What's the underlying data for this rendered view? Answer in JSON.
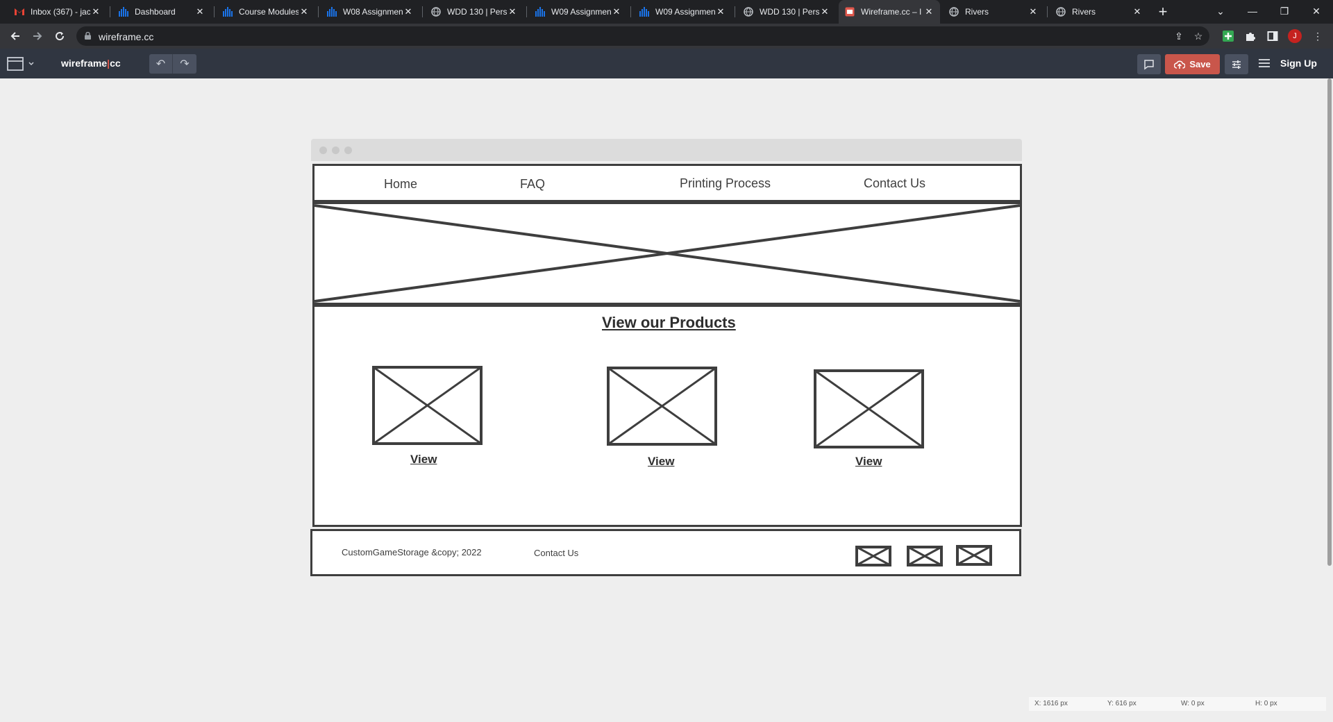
{
  "browser": {
    "tabs": [
      {
        "title": "Inbox (367) - jac",
        "icon": "gmail-icon",
        "active": false
      },
      {
        "title": "Dashboard",
        "icon": "canvas-icon",
        "active": false
      },
      {
        "title": "Course Modules",
        "icon": "canvas-icon",
        "active": false
      },
      {
        "title": "W08 Assignmen",
        "icon": "canvas-icon",
        "active": false
      },
      {
        "title": "WDD 130 | Pers",
        "icon": "globe-icon",
        "active": false
      },
      {
        "title": "W09 Assignmen",
        "icon": "canvas-icon",
        "active": false
      },
      {
        "title": "W09 Assignmen",
        "icon": "canvas-icon",
        "active": false
      },
      {
        "title": "WDD 130 | Pers",
        "icon": "globe-icon",
        "active": false
      },
      {
        "title": "Wireframe.cc – I",
        "icon": "wireframe-icon",
        "active": true
      },
      {
        "title": "Rivers",
        "icon": "globe-icon",
        "active": false
      },
      {
        "title": "Rivers",
        "icon": "globe-icon",
        "active": false
      }
    ],
    "url": "wireframe.cc",
    "profile_initial": "J",
    "accent_color": "#c9564b"
  },
  "app": {
    "logo_left": "wireframe",
    "logo_sep": "|",
    "logo_right": "cc",
    "save_label": "Save",
    "signup_label": "Sign Up"
  },
  "wireframe": {
    "nav": [
      "Home",
      "FAQ",
      "Printing Process",
      "Contact Us"
    ],
    "section_title": "View our Products",
    "product_links": [
      "View",
      "View",
      "View"
    ],
    "footer_copyright": "CustomGameStorage &copy; 2022",
    "footer_contact": "Contact Us"
  },
  "status": {
    "x": "X: 1616 px",
    "y": "Y: 616 px",
    "w": "W: 0 px",
    "h": "H: 0 px"
  }
}
